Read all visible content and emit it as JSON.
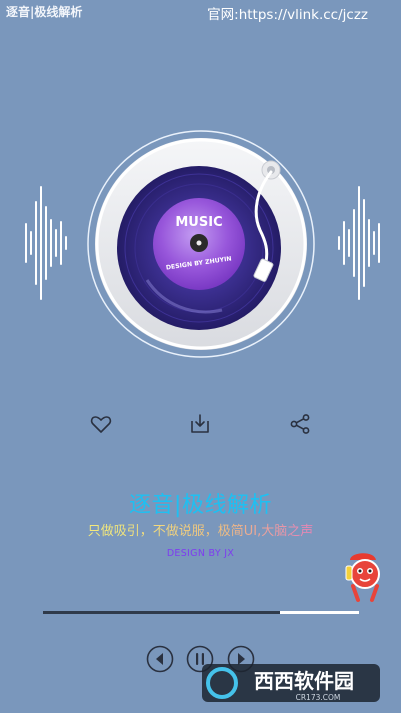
{
  "header": {
    "app_title": "逐音|极线解析",
    "official_url": "官网:https://vlink.cc/jczz"
  },
  "player": {
    "record_label": "MUSIC",
    "record_subtext": "DESIGN BY ZHUYIN",
    "progress": 0.75
  },
  "actions": [
    "heart-icon",
    "download-icon",
    "share-icon"
  ],
  "info": {
    "title": "逐音|极线解析",
    "slogan": "只做吸引，不做说服，极简UI,大脑之声",
    "designer": "DESIGN BY JX"
  },
  "controls": [
    "previous-icon",
    "pause-icon",
    "next-icon"
  ],
  "watermark": {
    "brand": "西西软件园",
    "domain": "CR173.COM"
  },
  "colors": {
    "background": "#7a97bc",
    "title": "#1ec0f2",
    "designer": "#7e3cf0"
  }
}
